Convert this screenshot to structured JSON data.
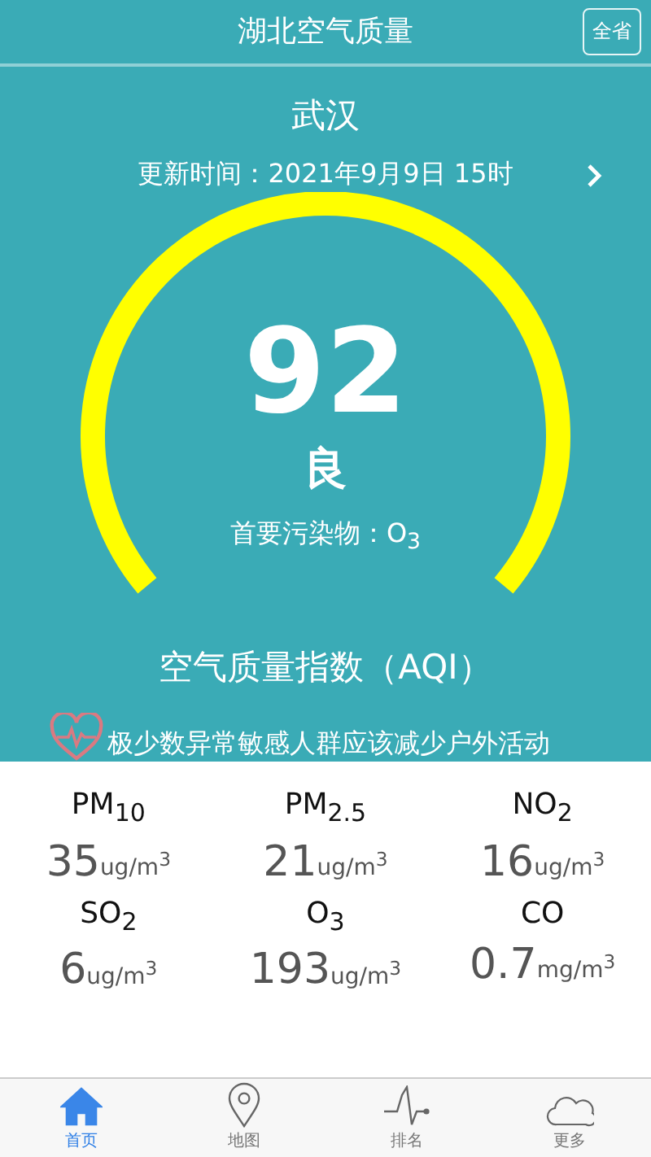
{
  "header": {
    "title": "湖北空气质量",
    "province_button": "全省"
  },
  "city": "武汉",
  "update_time": "更新时间：2021年9月9日 15时",
  "aqi": {
    "value": "92",
    "grade": "良",
    "primary_pollutant": "首要污染物：O$_{3}$",
    "title": "空气质量指数（AQI）"
  },
  "health_advice": "极少数异常敏感人群应该减少户外活动",
  "pollutants": [
    {
      "name": "PM$_{10}$",
      "value": "35",
      "unit": "ug/m$^{3}$"
    },
    {
      "name": "PM$_{2.5}$",
      "value": "21",
      "unit": "ug/m$^{3}$"
    },
    {
      "name": "NO$_{2}$",
      "value": "16",
      "unit": "ug/m$^{3}$"
    },
    {
      "name": "SO$_{2}$",
      "value": "6",
      "unit": "ug/m$^{3}$"
    },
    {
      "name": "O$_{3}$",
      "value": "193",
      "unit": "ug/m$^{3}$"
    },
    {
      "name": "CO",
      "value": "0.7",
      "unit": "mg/m$^{3}$"
    }
  ],
  "tabs": [
    {
      "label": "首页",
      "kind": "home",
      "selected": true
    },
    {
      "label": "地图",
      "kind": "map",
      "selected": false
    },
    {
      "label": "排名",
      "kind": "pulse",
      "selected": false
    },
    {
      "label": "更多",
      "kind": "cloud",
      "selected": false
    }
  ]
}
